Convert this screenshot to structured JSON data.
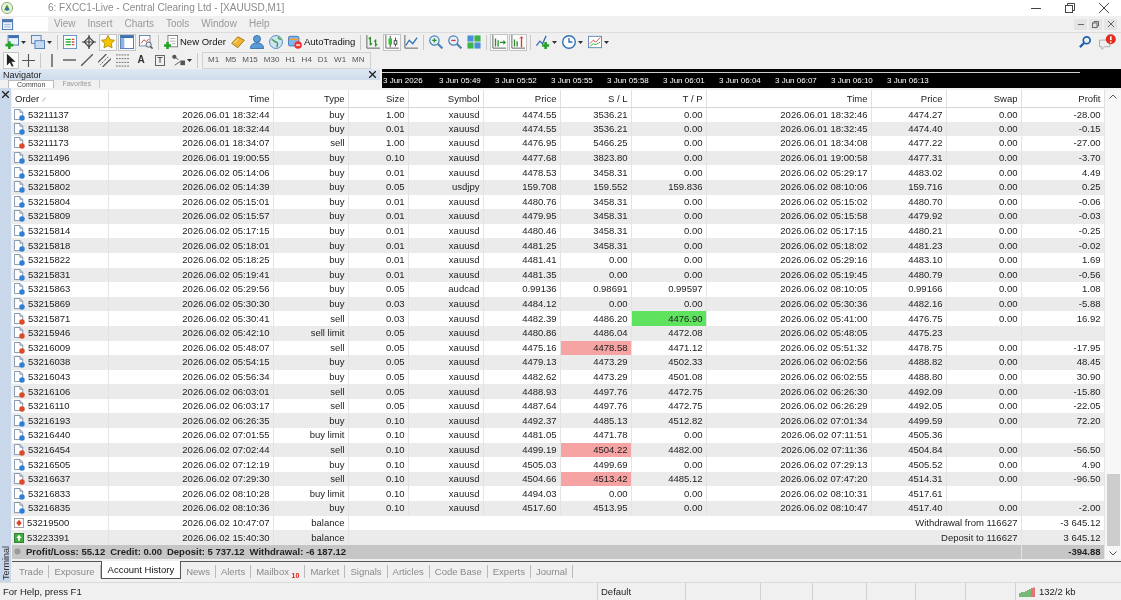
{
  "window": {
    "title": "6: FXCC1-Live - Central Clearing Ltd - [XAUUSD,M1]"
  },
  "menu": [
    "View",
    "Insert",
    "Charts",
    "Tools",
    "Window",
    "Help"
  ],
  "toolbar": {
    "groups": [
      [
        {
          "kind": "new_chart",
          "pressed": false
        },
        {
          "kind": "profiles",
          "pressed": false
        }
      ],
      [
        {
          "kind": "market_watch",
          "pressed": false
        },
        {
          "kind": "data_window",
          "pressed": false
        },
        {
          "kind": "navigator",
          "pressed": true
        },
        {
          "kind": "terminal",
          "pressed": true
        },
        {
          "kind": "tester",
          "pressed": false
        }
      ],
      [
        {
          "kind": "new_order",
          "label": "New Order",
          "pressed": false
        },
        {
          "kind": "editor",
          "pressed": false
        },
        {
          "kind": "community",
          "pressed": false
        },
        {
          "kind": "globe",
          "pressed": false
        },
        {
          "kind": "autotrading",
          "label": "AutoTrading",
          "pressed": false
        }
      ],
      [
        {
          "kind": "bar_chart",
          "pressed": false
        },
        {
          "kind": "candles",
          "pressed": true
        },
        {
          "kind": "line_chart",
          "pressed": false
        }
      ],
      [
        {
          "kind": "zoom_in",
          "pressed": false
        },
        {
          "kind": "zoom_out",
          "pressed": false
        },
        {
          "kind": "tile",
          "pressed": false
        }
      ],
      [
        {
          "kind": "autoscroll",
          "pressed": true
        },
        {
          "kind": "shift",
          "pressed": true
        }
      ],
      [
        {
          "kind": "indicators",
          "pressed": false
        },
        {
          "kind": "periods",
          "pressed": false
        },
        {
          "kind": "templates",
          "pressed": false
        }
      ]
    ]
  },
  "drawing_toolbar": {
    "groups": [
      [
        {
          "kind": "cursor",
          "pressed": true
        },
        {
          "kind": "crosshair",
          "pressed": false
        }
      ],
      [
        {
          "kind": "vline",
          "pressed": false
        },
        {
          "kind": "hline",
          "pressed": false
        },
        {
          "kind": "trend",
          "pressed": false
        },
        {
          "kind": "channel",
          "pressed": false
        },
        {
          "kind": "fibo",
          "pressed": false
        },
        {
          "kind": "text",
          "glyph": "A",
          "pressed": false
        },
        {
          "kind": "label",
          "glyph": "T",
          "pressed": false
        },
        {
          "kind": "shapes",
          "pressed": false
        }
      ]
    ],
    "timeframes": [
      "M1",
      "M5",
      "M15",
      "M30",
      "H1",
      "H4",
      "D1",
      "W1",
      "MN"
    ]
  },
  "navigator": {
    "title": "Navigator",
    "tabs": [
      {
        "label": "Common",
        "selected": true
      },
      {
        "label": "Favorites",
        "selected": false
      }
    ]
  },
  "time_axis": {
    "labels": [
      "3 Jun 2026",
      "3 Jun 05:49",
      "3 Jun 05:52",
      "3 Jun 05:55",
      "3 Jun 05:58",
      "3 Jun 06:01",
      "3 Jun 06:04",
      "3 Jun 06:07",
      "3 Jun 06:10",
      "3 Jun 06:13"
    ]
  },
  "terminal": {
    "title": "Terminal",
    "columns": [
      {
        "label": "Order",
        "sorted": true
      },
      {
        "label": "Time",
        "sorted": false
      },
      {
        "label": "Type",
        "sorted": false
      },
      {
        "label": "Size",
        "sorted": false
      },
      {
        "label": "Symbol",
        "sorted": false
      },
      {
        "label": "Price",
        "sorted": false
      },
      {
        "label": "S / L",
        "sorted": false
      },
      {
        "label": "T / P",
        "sorted": false
      },
      {
        "label": "Time",
        "sorted": false
      },
      {
        "label": "Price",
        "sorted": false
      },
      {
        "label": "Swap",
        "sorted": false
      },
      {
        "label": "Profit",
        "sorted": false
      }
    ],
    "rows": [
      {
        "kind": "buy",
        "order": "53211137",
        "time": "2026.06.01 18:32:44",
        "type": "buy",
        "size": "1.00",
        "symbol": "xauusd",
        "price": "4474.55",
        "sl": "3536.21",
        "tp": "0.00",
        "sl_hit": false,
        "tp_hit": false,
        "close_time": "2026.06.01 18:32:46",
        "close_price": "4474.27",
        "swap": "0.00",
        "profit": "-28.00"
      },
      {
        "kind": "buy",
        "order": "53211138",
        "time": "2026.06.01 18:32:44",
        "type": "buy",
        "size": "0.01",
        "symbol": "xauusd",
        "price": "4474.55",
        "sl": "3536.21",
        "tp": "0.00",
        "sl_hit": false,
        "tp_hit": false,
        "close_time": "2026.06.01 18:32:45",
        "close_price": "4474.40",
        "swap": "0.00",
        "profit": "-0.15"
      },
      {
        "kind": "sell",
        "order": "53211173",
        "time": "2026.06.01 18:34:07",
        "type": "sell",
        "size": "1.00",
        "symbol": "xauusd",
        "price": "4476.95",
        "sl": "5466.25",
        "tp": "0.00",
        "sl_hit": false,
        "tp_hit": false,
        "close_time": "2026.06.01 18:34:08",
        "close_price": "4477.22",
        "swap": "0.00",
        "profit": "-27.00"
      },
      {
        "kind": "buy",
        "order": "53211496",
        "time": "2026.06.01 19:00:55",
        "type": "buy",
        "size": "0.10",
        "symbol": "xauusd",
        "price": "4477.68",
        "sl": "3823.80",
        "tp": "0.00",
        "sl_hit": false,
        "tp_hit": false,
        "close_time": "2026.06.01 19:00:58",
        "close_price": "4477.31",
        "swap": "0.00",
        "profit": "-3.70"
      },
      {
        "kind": "buy",
        "order": "53215800",
        "time": "2026.06.02 05:14:06",
        "type": "buy",
        "size": "0.01",
        "symbol": "xauusd",
        "price": "4478.53",
        "sl": "3458.31",
        "tp": "0.00",
        "sl_hit": false,
        "tp_hit": false,
        "close_time": "2026.06.02 05:29:17",
        "close_price": "4483.02",
        "swap": "0.00",
        "profit": "4.49"
      },
      {
        "kind": "buy",
        "order": "53215802",
        "time": "2026.06.02 05:14:39",
        "type": "buy",
        "size": "0.05",
        "symbol": "usdjpy",
        "price": "159.708",
        "sl": "159.552",
        "tp": "159.836",
        "sl_hit": false,
        "tp_hit": false,
        "close_time": "2026.06.02 08:10:06",
        "close_price": "159.716",
        "swap": "0.00",
        "profit": "0.25"
      },
      {
        "kind": "buy",
        "order": "53215804",
        "time": "2026.06.02 05:15:01",
        "type": "buy",
        "size": "0.01",
        "symbol": "xauusd",
        "price": "4480.76",
        "sl": "3458.31",
        "tp": "0.00",
        "sl_hit": false,
        "tp_hit": false,
        "close_time": "2026.06.02 05:15:02",
        "close_price": "4480.70",
        "swap": "0.00",
        "profit": "-0.06"
      },
      {
        "kind": "buy",
        "order": "53215809",
        "time": "2026.06.02 05:15:57",
        "type": "buy",
        "size": "0.01",
        "symbol": "xauusd",
        "price": "4479.95",
        "sl": "3458.31",
        "tp": "0.00",
        "sl_hit": false,
        "tp_hit": false,
        "close_time": "2026.06.02 05:15:58",
        "close_price": "4479.92",
        "swap": "0.00",
        "profit": "-0.03"
      },
      {
        "kind": "buy",
        "order": "53215814",
        "time": "2026.06.02 05:17:15",
        "type": "buy",
        "size": "0.01",
        "symbol": "xauusd",
        "price": "4480.46",
        "sl": "3458.31",
        "tp": "0.00",
        "sl_hit": false,
        "tp_hit": false,
        "close_time": "2026.06.02 05:17:15",
        "close_price": "4480.21",
        "swap": "0.00",
        "profit": "-0.25"
      },
      {
        "kind": "buy",
        "order": "53215818",
        "time": "2026.06.02 05:18:01",
        "type": "buy",
        "size": "0.01",
        "symbol": "xauusd",
        "price": "4481.25",
        "sl": "3458.31",
        "tp": "0.00",
        "sl_hit": false,
        "tp_hit": false,
        "close_time": "2026.06.02 05:18:02",
        "close_price": "4481.23",
        "swap": "0.00",
        "profit": "-0.02"
      },
      {
        "kind": "buy",
        "order": "53215822",
        "time": "2026.06.02 05:18:25",
        "type": "buy",
        "size": "0.01",
        "symbol": "xauusd",
        "price": "4481.41",
        "sl": "0.00",
        "tp": "0.00",
        "sl_hit": false,
        "tp_hit": false,
        "close_time": "2026.06.02 05:29:16",
        "close_price": "4483.10",
        "swap": "0.00",
        "profit": "1.69"
      },
      {
        "kind": "buy",
        "order": "53215831",
        "time": "2026.06.02 05:19:41",
        "type": "buy",
        "size": "0.01",
        "symbol": "xauusd",
        "price": "4481.35",
        "sl": "0.00",
        "tp": "0.00",
        "sl_hit": false,
        "tp_hit": false,
        "close_time": "2026.06.02 05:19:45",
        "close_price": "4480.79",
        "swap": "0.00",
        "profit": "-0.56"
      },
      {
        "kind": "buy",
        "order": "53215863",
        "time": "2026.06.02 05:29:56",
        "type": "buy",
        "size": "0.05",
        "symbol": "audcad",
        "price": "0.99136",
        "sl": "0.98691",
        "tp": "0.99597",
        "sl_hit": false,
        "tp_hit": false,
        "close_time": "2026.06.02 08:10:05",
        "close_price": "0.99166",
        "swap": "0.00",
        "profit": "1.08"
      },
      {
        "kind": "buy",
        "order": "53215869",
        "time": "2026.06.02 05:30:30",
        "type": "buy",
        "size": "0.03",
        "symbol": "xauusd",
        "price": "4484.12",
        "sl": "0.00",
        "tp": "0.00",
        "sl_hit": false,
        "tp_hit": false,
        "close_time": "2026.06.02 05:30:36",
        "close_price": "4482.16",
        "swap": "0.00",
        "profit": "-5.88"
      },
      {
        "kind": "sell",
        "order": "53215871",
        "time": "2026.06.02 05:30:41",
        "type": "sell",
        "size": "0.03",
        "symbol": "xauusd",
        "price": "4482.39",
        "sl": "4486.20",
        "tp": "4476.90",
        "sl_hit": false,
        "tp_hit": true,
        "close_time": "2026.06.02 05:41:00",
        "close_price": "4476.75",
        "swap": "0.00",
        "profit": "16.92"
      },
      {
        "kind": "sell",
        "order": "53215946",
        "time": "2026.06.02 05:42:10",
        "type": "sell limit",
        "size": "0.05",
        "symbol": "xauusd",
        "price": "4480.86",
        "sl": "4486.04",
        "tp": "4472.08",
        "sl_hit": false,
        "tp_hit": false,
        "close_time": "2026.06.02 05:48:05",
        "close_price": "4475.23"
      },
      {
        "kind": "sell",
        "order": "53216009",
        "time": "2026.06.02 05:48:07",
        "type": "sell",
        "size": "0.05",
        "symbol": "xauusd",
        "price": "4475.16",
        "sl": "4478.58",
        "tp": "4471.12",
        "sl_hit": true,
        "tp_hit": false,
        "close_time": "2026.06.02 05:51:32",
        "close_price": "4478.75",
        "swap": "0.00",
        "profit": "-17.95"
      },
      {
        "kind": "buy",
        "order": "53216038",
        "time": "2026.06.02 05:54:15",
        "type": "buy",
        "size": "0.05",
        "symbol": "xauusd",
        "price": "4479.13",
        "sl": "4473.29",
        "tp": "4502.33",
        "sl_hit": false,
        "tp_hit": false,
        "close_time": "2026.06.02 06:02:56",
        "close_price": "4488.82",
        "swap": "0.00",
        "profit": "48.45"
      },
      {
        "kind": "buy",
        "order": "53216043",
        "time": "2026.06.02 05:56:34",
        "type": "buy",
        "size": "0.05",
        "symbol": "xauusd",
        "price": "4482.62",
        "sl": "4473.29",
        "tp": "4501.08",
        "sl_hit": false,
        "tp_hit": false,
        "close_time": "2026.06.02 06:02:55",
        "close_price": "4488.80",
        "swap": "0.00",
        "profit": "30.90"
      },
      {
        "kind": "sell",
        "order": "53216106",
        "time": "2026.06.02 06:03:01",
        "type": "sell",
        "size": "0.05",
        "symbol": "xauusd",
        "price": "4488.93",
        "sl": "4497.76",
        "tp": "4472.75",
        "sl_hit": false,
        "tp_hit": false,
        "close_time": "2026.06.02 06:26:30",
        "close_price": "4492.09",
        "swap": "0.00",
        "profit": "-15.80"
      },
      {
        "kind": "sell",
        "order": "53216110",
        "time": "2026.06.02 06:03:17",
        "type": "sell",
        "size": "0.05",
        "symbol": "xauusd",
        "price": "4487.64",
        "sl": "4497.76",
        "tp": "4472.75",
        "sl_hit": false,
        "tp_hit": false,
        "close_time": "2026.06.02 06:26:29",
        "close_price": "4492.05",
        "swap": "0.00",
        "profit": "-22.05"
      },
      {
        "kind": "buy",
        "order": "53216193",
        "time": "2026.06.02 06:26:35",
        "type": "buy",
        "size": "0.10",
        "symbol": "xauusd",
        "price": "4492.37",
        "sl": "4485.13",
        "tp": "4512.82",
        "sl_hit": false,
        "tp_hit": false,
        "close_time": "2026.06.02 07:01:34",
        "close_price": "4499.59",
        "swap": "0.00",
        "profit": "72.20"
      },
      {
        "kind": "buy",
        "order": "53216440",
        "time": "2026.06.02 07:01:55",
        "type": "buy limit",
        "size": "0.10",
        "symbol": "xauusd",
        "price": "4481.05",
        "sl": "4471.78",
        "tp": "0.00",
        "sl_hit": false,
        "tp_hit": false,
        "close_time": "2026.06.02 07:11:51",
        "close_price": "4505.36"
      },
      {
        "kind": "sell",
        "order": "53216454",
        "time": "2026.06.02 07:02:44",
        "type": "sell",
        "size": "0.10",
        "symbol": "xauusd",
        "price": "4499.19",
        "sl": "4504.22",
        "tp": "4482.00",
        "sl_hit": true,
        "tp_hit": false,
        "close_time": "2026.06.02 07:11:36",
        "close_price": "4504.84",
        "swap": "0.00",
        "profit": "-56.50"
      },
      {
        "kind": "buy",
        "order": "53216505",
        "time": "2026.06.02 07:12:19",
        "type": "buy",
        "size": "0.10",
        "symbol": "xauusd",
        "price": "4505.03",
        "sl": "4499.69",
        "tp": "0.00",
        "sl_hit": false,
        "tp_hit": false,
        "close_time": "2026.06.02 07:29:13",
        "close_price": "4505.52",
        "swap": "0.00",
        "profit": "4.90"
      },
      {
        "kind": "sell",
        "order": "53216637",
        "time": "2026.06.02 07:29:30",
        "type": "sell",
        "size": "0.10",
        "symbol": "xauusd",
        "price": "4504.66",
        "sl": "4513.42",
        "tp": "4485.12",
        "sl_hit": true,
        "tp_hit": false,
        "close_time": "2026.06.02 07:47:20",
        "close_price": "4514.31",
        "swap": "0.00",
        "profit": "-96.50"
      },
      {
        "kind": "buy",
        "order": "53216833",
        "time": "2026.06.02 08:10:28",
        "type": "buy limit",
        "size": "0.10",
        "symbol": "xauusd",
        "price": "4494.03",
        "sl": "0.00",
        "tp": "0.00",
        "sl_hit": false,
        "tp_hit": false,
        "close_time": "2026.06.02 08:10:31",
        "close_price": "4517.61"
      },
      {
        "kind": "buy",
        "order": "53216835",
        "time": "2026.06.02 08:10:36",
        "type": "buy",
        "size": "0.10",
        "symbol": "xauusd",
        "price": "4517.60",
        "sl": "4513.95",
        "tp": "0.00",
        "sl_hit": false,
        "tp_hit": false,
        "close_time": "2026.06.02 08:10:47",
        "close_price": "4517.40",
        "swap": "0.00",
        "profit": "-2.00"
      },
      {
        "kind": "debit",
        "order": "53219500",
        "time": "2026.06.02 10:47:07",
        "type": "balance",
        "comment": "Withdrawal from 116627",
        "profit": "-3 645.12"
      },
      {
        "kind": "credit",
        "order": "53223391",
        "time": "2026.06.02 15:40:30",
        "type": "balance",
        "comment": "Deposit to 116627",
        "profit": "3 645.12"
      }
    ],
    "summary": {
      "items": [
        "Profit/Loss: 55.12",
        "Credit: 0.00",
        "Deposit: 5 737.12",
        "Withdrawal: -6 187.12"
      ],
      "total": "-394.88"
    },
    "tabs": [
      {
        "label": "Trade",
        "selected": false
      },
      {
        "label": "Exposure",
        "selected": false
      },
      {
        "label": "Account History",
        "selected": true
      },
      {
        "label": "News",
        "selected": false
      },
      {
        "label": "Alerts",
        "selected": false
      },
      {
        "label": "Mailbox",
        "count": "10",
        "selected": false
      },
      {
        "label": "Market",
        "selected": false
      },
      {
        "label": "Signals",
        "selected": false
      },
      {
        "label": "Articles",
        "selected": false
      },
      {
        "label": "Code Base",
        "selected": false
      },
      {
        "label": "Experts",
        "selected": false
      },
      {
        "label": "Journal",
        "selected": false
      }
    ]
  },
  "status_bar": {
    "help": "For Help, press F1",
    "profile": "Default",
    "traffic": "132/2 kb"
  }
}
